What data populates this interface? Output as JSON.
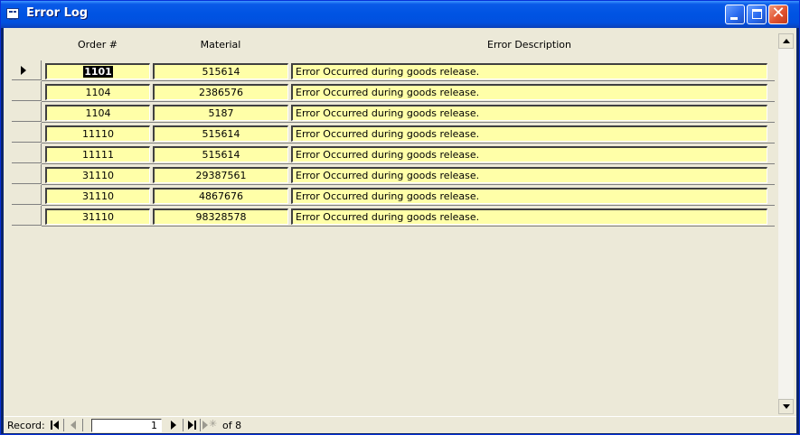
{
  "window": {
    "title": "Error Log"
  },
  "columns": {
    "order": "Order #",
    "material": "Material",
    "description": "Error Description"
  },
  "rows": [
    {
      "order": "1101",
      "material": "515614",
      "description": "Error Occurred during goods release."
    },
    {
      "order": "1104",
      "material": "2386576",
      "description": "Error Occurred during goods release."
    },
    {
      "order": "1104",
      "material": "5187",
      "description": "Error Occurred during goods release."
    },
    {
      "order": "11110",
      "material": "515614",
      "description": "Error Occurred during goods release."
    },
    {
      "order": "11111",
      "material": "515614",
      "description": "Error Occurred during goods release."
    },
    {
      "order": "31110",
      "material": "29387561",
      "description": "Error Occurred during goods release."
    },
    {
      "order": "31110",
      "material": "4867676",
      "description": "Error Occurred during goods release."
    },
    {
      "order": "31110",
      "material": "98328578",
      "description": "Error Occurred during goods release."
    }
  ],
  "current_row": 1,
  "navigation": {
    "label": "Record:",
    "current": "1",
    "total_text": "of 8"
  },
  "colors": {
    "field_bg": "#ffffa8",
    "titlebar": "#0054e3",
    "client_bg": "#ece9d8"
  },
  "icons": [
    "form-view-icon",
    "minimize-icon",
    "maximize-icon",
    "close-icon",
    "record-selector-arrow-icon",
    "scroll-up-icon",
    "scroll-down-icon",
    "first-record-icon",
    "previous-record-icon",
    "next-record-icon",
    "last-record-icon",
    "new-record-icon"
  ]
}
